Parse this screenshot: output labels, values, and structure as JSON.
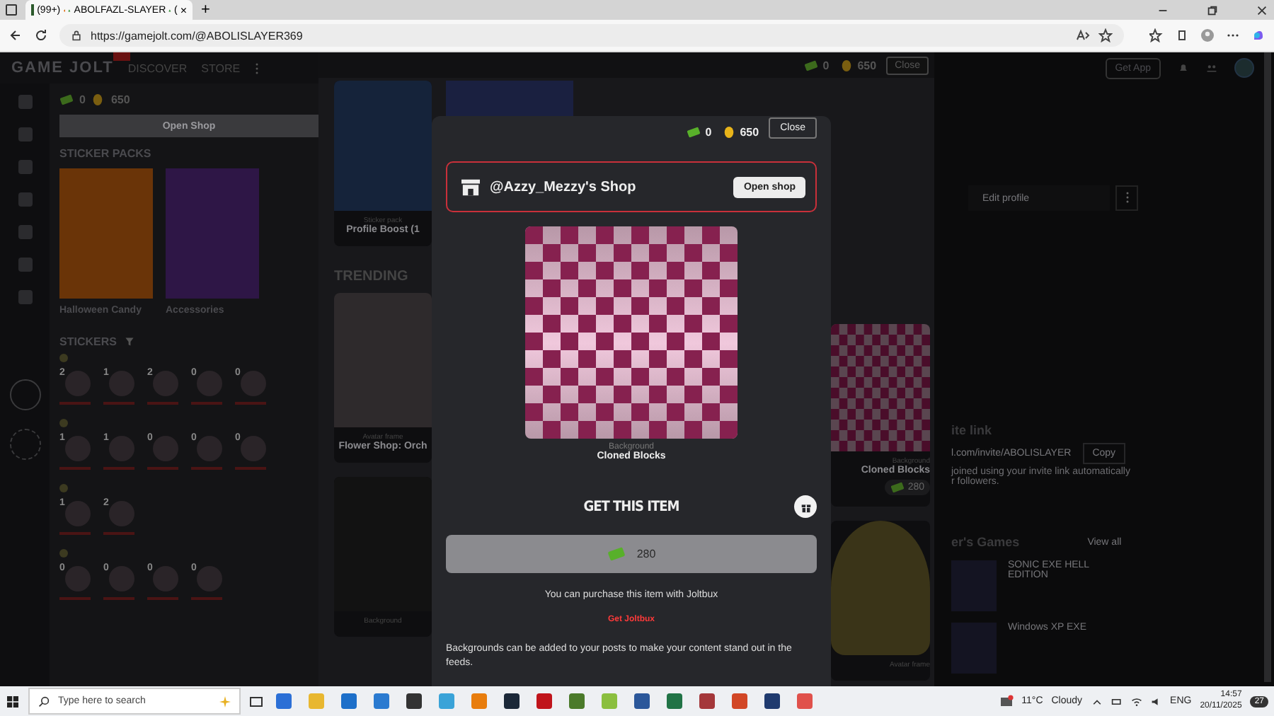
{
  "browser": {
    "tab_count": "(99+)",
    "tab_title": "ABOLFAZL-SLAYER",
    "tab_tail": "(",
    "tab_close": "×",
    "new_tab": "+",
    "address": "https://gamejolt.com/@ABOLISLAYER369"
  },
  "nav": {
    "logo": "GAME JOLT",
    "links": [
      "DISCOVER",
      "STORE"
    ]
  },
  "drawer": {
    "joltbux": "0",
    "coins": "650",
    "open_shop": "Open Shop",
    "packs_title": "STICKER PACKS",
    "packs": [
      {
        "name": "Halloween Candy",
        "color": "#6a3408"
      },
      {
        "name": "Accessories",
        "color": "#2e1646"
      }
    ],
    "stickers_title": "STICKERS",
    "groups": [
      {
        "counts": [
          "2",
          "1",
          "2",
          "0",
          "0"
        ]
      },
      {
        "counts": [
          "1",
          "1",
          "0",
          "0",
          "0"
        ]
      },
      {
        "counts": [
          "1",
          "2"
        ]
      },
      {
        "counts": [
          "0",
          "0",
          "0",
          "0"
        ]
      }
    ]
  },
  "store": {
    "joltbux": "0",
    "coins": "650",
    "close": "Close",
    "trending": "TRENDING",
    "left_cards": [
      {
        "type": "Sticker pack",
        "name": "Profile Boost (1"
      },
      {
        "type": "Avatar frame",
        "name": "Flower Shop: Orch"
      },
      {
        "type": "Background"
      }
    ],
    "right_cards": [
      {
        "type": "Background",
        "name": "Cloned Blocks",
        "price": "280"
      },
      {
        "type": "Avatar frame"
      }
    ]
  },
  "profile": {
    "get_app": "Get App",
    "edit_profile": "Edit profile",
    "invite_title": "ite link",
    "invite_url": "l.com/invite/ABOLISLAYER",
    "copy": "Copy",
    "invite_note": [
      "joined using your invite link automatically",
      "r followers."
    ],
    "games_title": "er's Games",
    "view_all": "View all",
    "games": [
      "SONIC EXE HELL EDITION",
      "Windows XP EXE"
    ]
  },
  "modal": {
    "joltbux": "0",
    "coins": "650",
    "close": "Close",
    "shop_name": "@Azzy_Mezzy's Shop",
    "open_shop": "Open shop",
    "item_type": "Background",
    "item_name": "Cloned Blocks",
    "get_title": "GET THIS ITEM",
    "price": "280",
    "purchase_note": "You can purchase this item with Joltbux",
    "get_joltbux": "Get Joltbux",
    "description": "Backgrounds can be added to your posts to make your content stand out in the feeds."
  },
  "taskbar": {
    "search_placeholder": "Type here to search",
    "temperature": "11°C",
    "weather": "Cloudy",
    "language": "ENG",
    "time": "14:57",
    "date": "20/11/2025",
    "notifications": "27"
  }
}
